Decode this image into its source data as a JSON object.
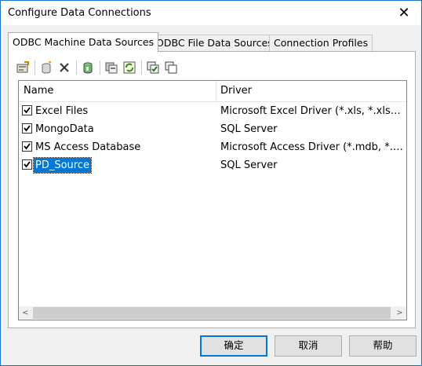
{
  "window": {
    "title": "Configure Data Connections",
    "close_glyph": "✕"
  },
  "tabs": [
    {
      "label": "ODBC Machine Data Sources",
      "active": true
    },
    {
      "label": "ODBC File Data Sources",
      "active": false
    },
    {
      "label": "Connection Profiles",
      "active": false
    }
  ],
  "toolbar": [
    {
      "icon": "properties-icon"
    },
    {
      "icon": "add-data-source-icon"
    },
    {
      "icon": "delete-icon"
    },
    {
      "icon": "odbc-admin-icon"
    },
    {
      "icon": "test-connection-icon"
    },
    {
      "icon": "refresh-icon"
    },
    {
      "icon": "check-all-icon"
    },
    {
      "icon": "uncheck-all-icon"
    }
  ],
  "table": {
    "columns": [
      "Name",
      "Driver"
    ],
    "rows": [
      {
        "name": "Excel Files",
        "driver": "Microsoft Excel Driver (*.xls, *.xlsx, *.xlsm, *.xlsb)",
        "checked": true,
        "selected": false
      },
      {
        "name": "MongoData",
        "driver": "SQL Server",
        "checked": true,
        "selected": false
      },
      {
        "name": "MS Access Database",
        "driver": "Microsoft Access Driver (*.mdb, *.accdb)",
        "checked": true,
        "selected": false
      },
      {
        "name": "PD_Source",
        "driver": "SQL Server",
        "checked": true,
        "selected": true
      }
    ]
  },
  "scrollbar": {
    "left": "<",
    "right": ">"
  },
  "buttons": {
    "ok": "确定",
    "cancel": "取消",
    "help": "帮助"
  },
  "colors": {
    "selection": "#0078d7",
    "accent_border": "#1c74c4"
  }
}
